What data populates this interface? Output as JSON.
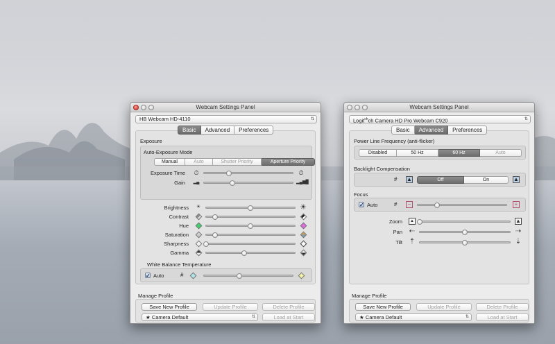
{
  "window1": {
    "title": "Webcam Settings Panel",
    "camera": "HB Webcam HD-4110",
    "tabs": [
      "Basic",
      "Advanced",
      "Preferences"
    ],
    "active_tab": 0,
    "exposure": {
      "label": "Exposure",
      "mode_label": "Auto-Exposure Mode",
      "modes": [
        "Manual",
        "Auto",
        "Shutter Priority",
        "Aperture Priority"
      ],
      "selected_mode": 3,
      "rows": [
        {
          "label": "Exposure Time",
          "value": 0.28,
          "left_icon": "clock-icon",
          "right_icon": "clock-icon"
        },
        {
          "label": "Gain",
          "value": 0.32,
          "left_icon": "signal-low-icon",
          "right_icon": "signal-high-icon"
        }
      ]
    },
    "image": [
      {
        "label": "Brightness",
        "value": 0.5,
        "left_icon": "sun-small-icon",
        "right_icon": "sun-large-icon"
      },
      {
        "label": "Contrast",
        "value": 0.1,
        "left_icon": "contrast-low-icon",
        "right_icon": "contrast-high-icon"
      },
      {
        "label": "Hue",
        "value": 0.5,
        "left_icon": "hue-green-icon",
        "right_icon": "hue-magenta-icon"
      },
      {
        "label": "Saturation",
        "value": 0.1,
        "left_icon": "saturation-low-icon",
        "right_icon": "saturation-high-icon"
      },
      {
        "label": "Sharpness",
        "value": 0.0,
        "left_icon": "sharpness-low-icon",
        "right_icon": "sharpness-high-icon"
      },
      {
        "label": "Gamma",
        "value": 0.43,
        "left_icon": "gamma-low-icon",
        "right_icon": "gamma-high-icon"
      }
    ],
    "white_balance": {
      "label": "White Balance Temperature",
      "auto_label": "Auto",
      "auto_checked": true,
      "hash": "#",
      "value": 0.4
    },
    "profile": {
      "label": "Manage Profile",
      "save": "Save New Profile",
      "update": "Update Profile",
      "delete": "Delete Profile",
      "selected": "Camera Default",
      "star": "★",
      "load": "Load at Start"
    }
  },
  "window2": {
    "title": "Webcam Settings Panel",
    "camera_prefix": "Logit",
    "camera_sup": "ch",
    "camera_suffix": "ch Camera HD Pro Webcam C920",
    "tabs": [
      "Basic",
      "Advanced",
      "Preferences"
    ],
    "active_tab": 1,
    "power_line": {
      "label": "Power Line Frequency (anti-flicker)",
      "options": [
        "Disabled",
        "50 Hz",
        "60 Hz",
        "Auto"
      ],
      "selected": 2
    },
    "backlight": {
      "label": "Backlight Compensation",
      "hash": "#",
      "options": [
        "Off",
        "On"
      ],
      "selected": 0
    },
    "focus": {
      "label": "Focus",
      "auto_label": "Auto",
      "auto_checked": true,
      "hash": "#",
      "value": 0.22,
      "minus": "−",
      "plus": "+"
    },
    "controls": [
      {
        "label": "Zoom",
        "value": 0.0,
        "left_icon": "zoom-out-icon",
        "right_icon": "zoom-in-icon"
      },
      {
        "label": "Pan",
        "value": 0.5,
        "left_icon": "pan-left-icon",
        "right_icon": "pan-right-icon"
      },
      {
        "label": "Tilt",
        "value": 0.5,
        "left_icon": "tilt-up-icon",
        "right_icon": "tilt-down-icon"
      }
    ],
    "profile": {
      "label": "Manage Profile",
      "save": "Save New Profile",
      "update": "Update Profile",
      "delete": "Delete Profile",
      "selected": "Camera Default",
      "star": "★",
      "load": "Load at Start"
    }
  }
}
